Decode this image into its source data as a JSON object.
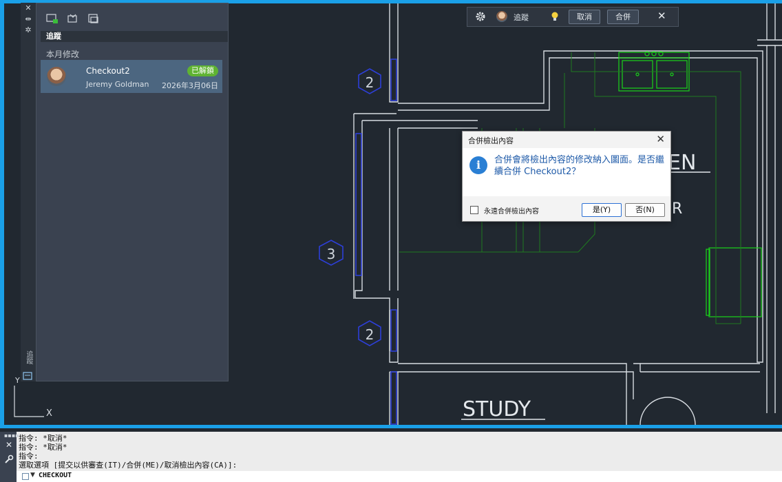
{
  "colors": {
    "canvas": "#212830",
    "viewport_border": "#1aa0e8",
    "wall_lines": "#d8dde2",
    "fixture_green": "#19d419",
    "tag_blue": "#2d3fd8",
    "badge_green": "#5fb332",
    "selected_row": "#4c6680"
  },
  "drawing": {
    "room_labels": [
      "STUDY",
      "EN",
      "R"
    ],
    "door_tags": [
      "2",
      "3",
      "2"
    ]
  },
  "trace_panel": {
    "title": "追蹤",
    "section_label": "本月修改",
    "side_label": "追蹤",
    "toolbar_icons": [
      "create-trace-icon",
      "import-trace-icon",
      "trace-options-icon"
    ],
    "item": {
      "name": "Checkout2",
      "badge": "已解鎖",
      "user": "Jeremy Goldman",
      "date": "2026年3月06日"
    }
  },
  "top_toolbar": {
    "trace_label": "追蹤",
    "cancel_label": "取消",
    "merge_label": "合併",
    "close_glyph": "✕"
  },
  "dialog": {
    "title": "合併檢出內容",
    "close_glyph": "✕",
    "message": "合併會將檢出內容的修改納入圖面。是否繼續合併 Checkout2？",
    "checkbox_label": "永遠合併檢出內容",
    "yes_label": "是(Y)",
    "no_label": "否(N)"
  },
  "command_line": {
    "history": [
      "指令: *取消*",
      "指令: *取消*",
      "指令:",
      "選取選項 [提交以供審查(IT)/合併(ME)/取消檢出內容(CA)]:"
    ],
    "current_command": "CHECKOUT"
  },
  "ucs": {
    "y_label": "Y",
    "x_label": "X"
  }
}
